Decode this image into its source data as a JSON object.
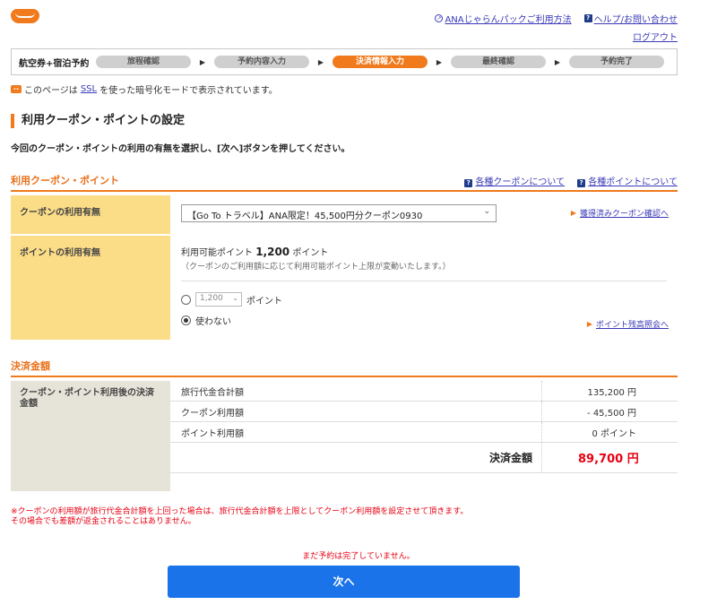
{
  "header": {
    "logo": "じゃらん",
    "links": [
      {
        "icon": "external-icon",
        "label": "ANAじゃらんパックご利用方法"
      },
      {
        "icon": "help-icon",
        "label": "ヘルプ/お問い合わせ"
      }
    ],
    "logout": "ログアウト"
  },
  "steps": {
    "label": "航空券+宿泊予約",
    "items": [
      "旅程確認",
      "予約内容入力",
      "決済情報入力",
      "最終確認",
      "予約完了"
    ],
    "active_index": 2
  },
  "ssl": {
    "prefix": "このページは",
    "link": "SSL",
    "suffix": "を使った暗号化モードで表示されています。"
  },
  "page": {
    "title": "利用クーポン・ポイントの設定",
    "intro": "今回のクーポン・ポイントの利用の有無を選択し、[次へ]ボタンを押してください。"
  },
  "coupon_section": {
    "title": "利用クーポン・ポイント",
    "links": [
      "各種クーポンについて",
      "各種ポイントについて"
    ],
    "coupon_label": "クーポンの利用有無",
    "coupon_selected": "【Go To トラベル】ANA限定！45,500円分クーポン0930",
    "coupon_link": "獲得済みクーポン確認へ",
    "point_label": "ポイントの利用有無",
    "point_avail_prefix": "利用可能ポイント",
    "point_avail_value": "1,200",
    "point_avail_suffix": "ポイント",
    "point_note": "（クーポンのご利用額に応じて利用可能ポイント上限が変動いたします。）",
    "point_select_value": "1,200",
    "point_unit": "ポイント",
    "point_no_use": "使わない",
    "point_link": "ポイント残高照会へ"
  },
  "payment_section": {
    "title": "決済金額",
    "label": "クーポン・ポイント利用後の決済金額",
    "rows": [
      {
        "key": "旅行代金合計額",
        "value": "135,200 円"
      },
      {
        "key": "クーポン利用額",
        "value": "- 45,500 円"
      },
      {
        "key": "ポイント利用額",
        "value": "0 ポイント"
      }
    ],
    "total_label": "決済金額",
    "total_value": "89,700 円"
  },
  "warning": {
    "line1": "※クーポンの利用額が旅行代金合計額を上回った場合は、旅行代金合計額を上限としてクーポン利用額を設定させて頂きます。",
    "line2": "その場合でも差額が返金されることはありません。"
  },
  "footer": {
    "not_done": "まだ予約は完了していません。",
    "next_button": "次へ"
  },
  "colors": {
    "accent": "#f07a1c",
    "yellow": "#fbdc87",
    "red": "#e60012",
    "button": "#1a73e8"
  }
}
